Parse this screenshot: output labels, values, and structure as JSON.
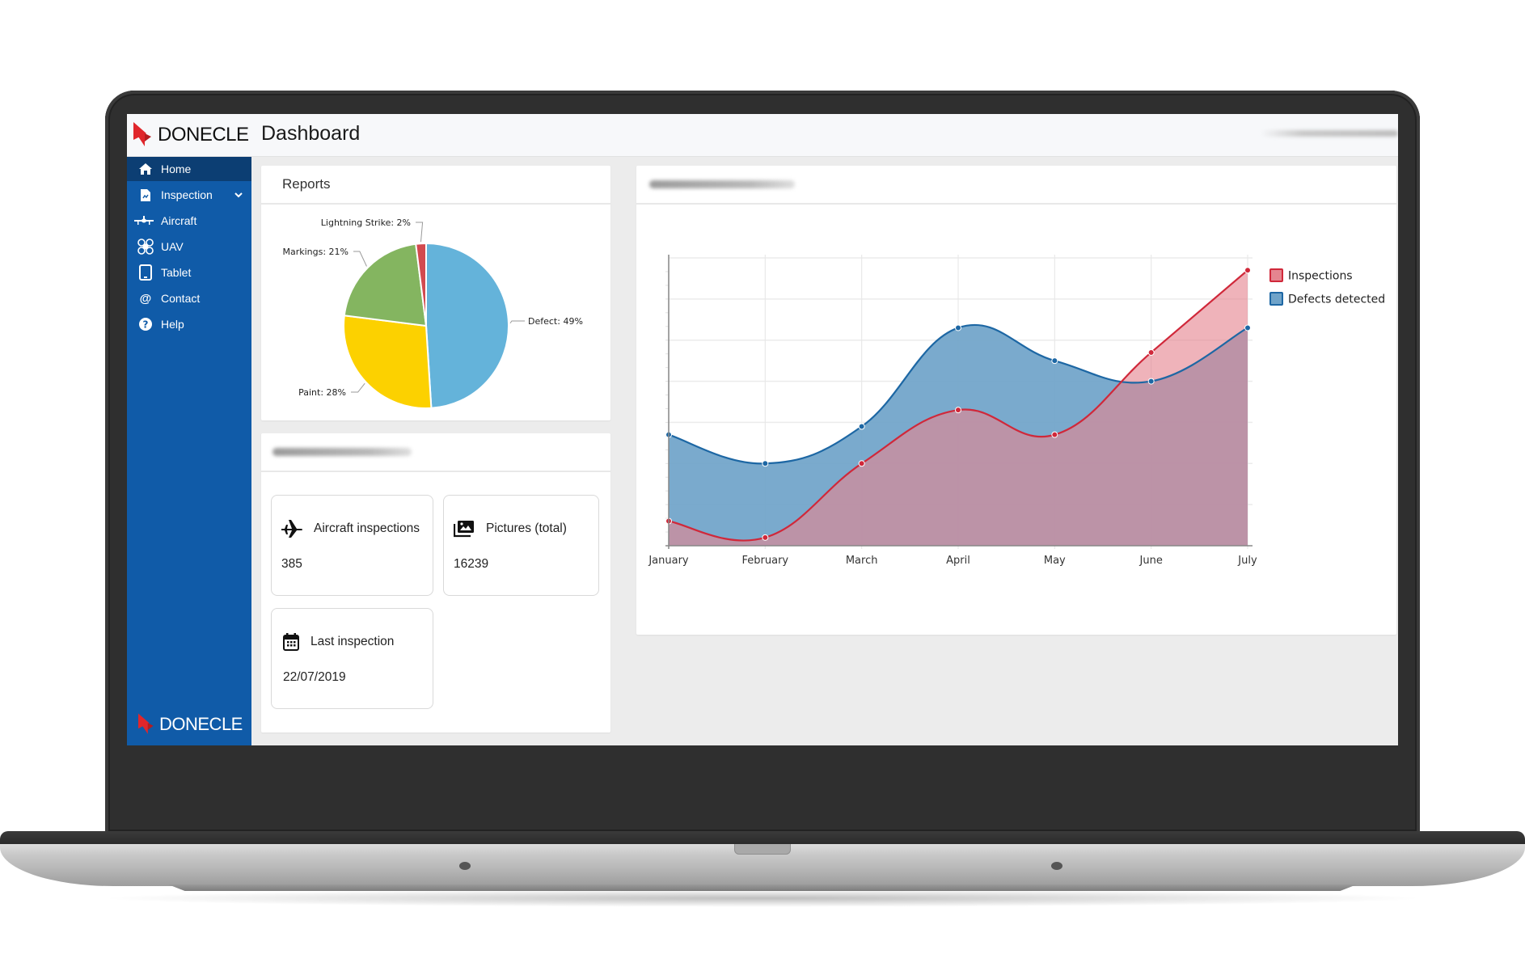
{
  "app": {
    "brand": "DONECLE",
    "page_title": "Dashboard",
    "accent_color": "#105ba8",
    "active_nav_color": "#0c3e73",
    "brand_red": "#e0262b"
  },
  "sidebar": {
    "items": [
      {
        "label": "Home",
        "icon": "home-icon",
        "active": true
      },
      {
        "label": "Inspection",
        "icon": "report-file-icon",
        "expandable": true
      },
      {
        "label": "Aircraft",
        "icon": "aircraft-icon"
      },
      {
        "label": "UAV",
        "icon": "drone-icon"
      },
      {
        "label": "Tablet",
        "icon": "tablet-icon"
      },
      {
        "label": "Contact",
        "icon": "at-sign-icon"
      },
      {
        "label": "Help",
        "icon": "question-circle-icon"
      }
    ],
    "footer_brand": "DONECLE"
  },
  "reports": {
    "title": "Reports"
  },
  "stats": {
    "cards": [
      {
        "label": "Aircraft inspections",
        "value": "385",
        "icon": "airplane-icon"
      },
      {
        "label": "Pictures (total)",
        "value": "16239",
        "icon": "photos-icon"
      },
      {
        "label": "Last inspection",
        "value": "22/07/2019",
        "icon": "calendar-icon"
      }
    ]
  },
  "chart_data": [
    {
      "type": "pie",
      "title": "Reports",
      "slices": [
        {
          "label": "Defect",
          "value": 49,
          "color": "#64b3da",
          "text": "Defect: 49%"
        },
        {
          "label": "Paint",
          "value": 28,
          "color": "#fcd100",
          "text": "Paint: 28%"
        },
        {
          "label": "Markings",
          "value": 21,
          "color": "#84b560",
          "text": "Markings: 21%"
        },
        {
          "label": "Lightning Strike",
          "value": 2,
          "color": "#d24a4f",
          "text": "Lightning Strike: 2%"
        }
      ],
      "start": "top",
      "direction": "clockwise"
    },
    {
      "type": "area",
      "title": "",
      "categories": [
        "January",
        "February",
        "March",
        "April",
        "May",
        "June",
        "July"
      ],
      "series": [
        {
          "name": "Inspections",
          "values": [
            6,
            2,
            20,
            33,
            27,
            47,
            67
          ],
          "line_color": "#d0283a",
          "fill_color": "#e5858f"
        },
        {
          "name": "Defects detected",
          "values": [
            27,
            20,
            29,
            53,
            45,
            40,
            53
          ],
          "line_color": "#1d67a4",
          "fill_color": "#6fa3c9"
        }
      ],
      "xlabel": "",
      "ylabel": "",
      "ylim": [
        0,
        70
      ],
      "y_tick_labels_shown": false,
      "grid": true,
      "smooth": true,
      "legend": "right"
    }
  ]
}
